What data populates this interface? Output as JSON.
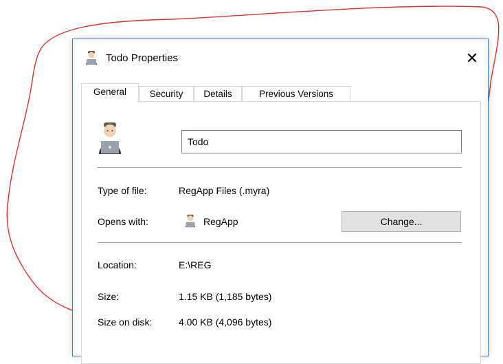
{
  "window": {
    "title": "Todo Properties",
    "close_glyph": "✕"
  },
  "tabs": [
    {
      "label": "General",
      "active": true
    },
    {
      "label": "Security",
      "active": false
    },
    {
      "label": "Details",
      "active": false
    },
    {
      "label": "Previous Versions",
      "active": false
    }
  ],
  "general": {
    "file_name": "Todo",
    "file_icon": "person-at-laptop-icon",
    "type_label": "Type of file:",
    "type_value": "RegApp Files (.myra)",
    "opens_label": "Opens with:",
    "opens_value": "RegApp",
    "opens_icon": "person-at-laptop-icon",
    "change_label": "Change...",
    "location_label": "Location:",
    "location_value": "E:\\REG",
    "size_label": "Size:",
    "size_value": "1.15 KB (1,185 bytes)",
    "size_on_disk_label": "Size on disk:",
    "size_on_disk_value": "4.00 KB (4,096 bytes)"
  },
  "colors": {
    "window_border": "#3c7fc3",
    "annotation": "#e0322d",
    "button_face": "#e1e1e1"
  }
}
